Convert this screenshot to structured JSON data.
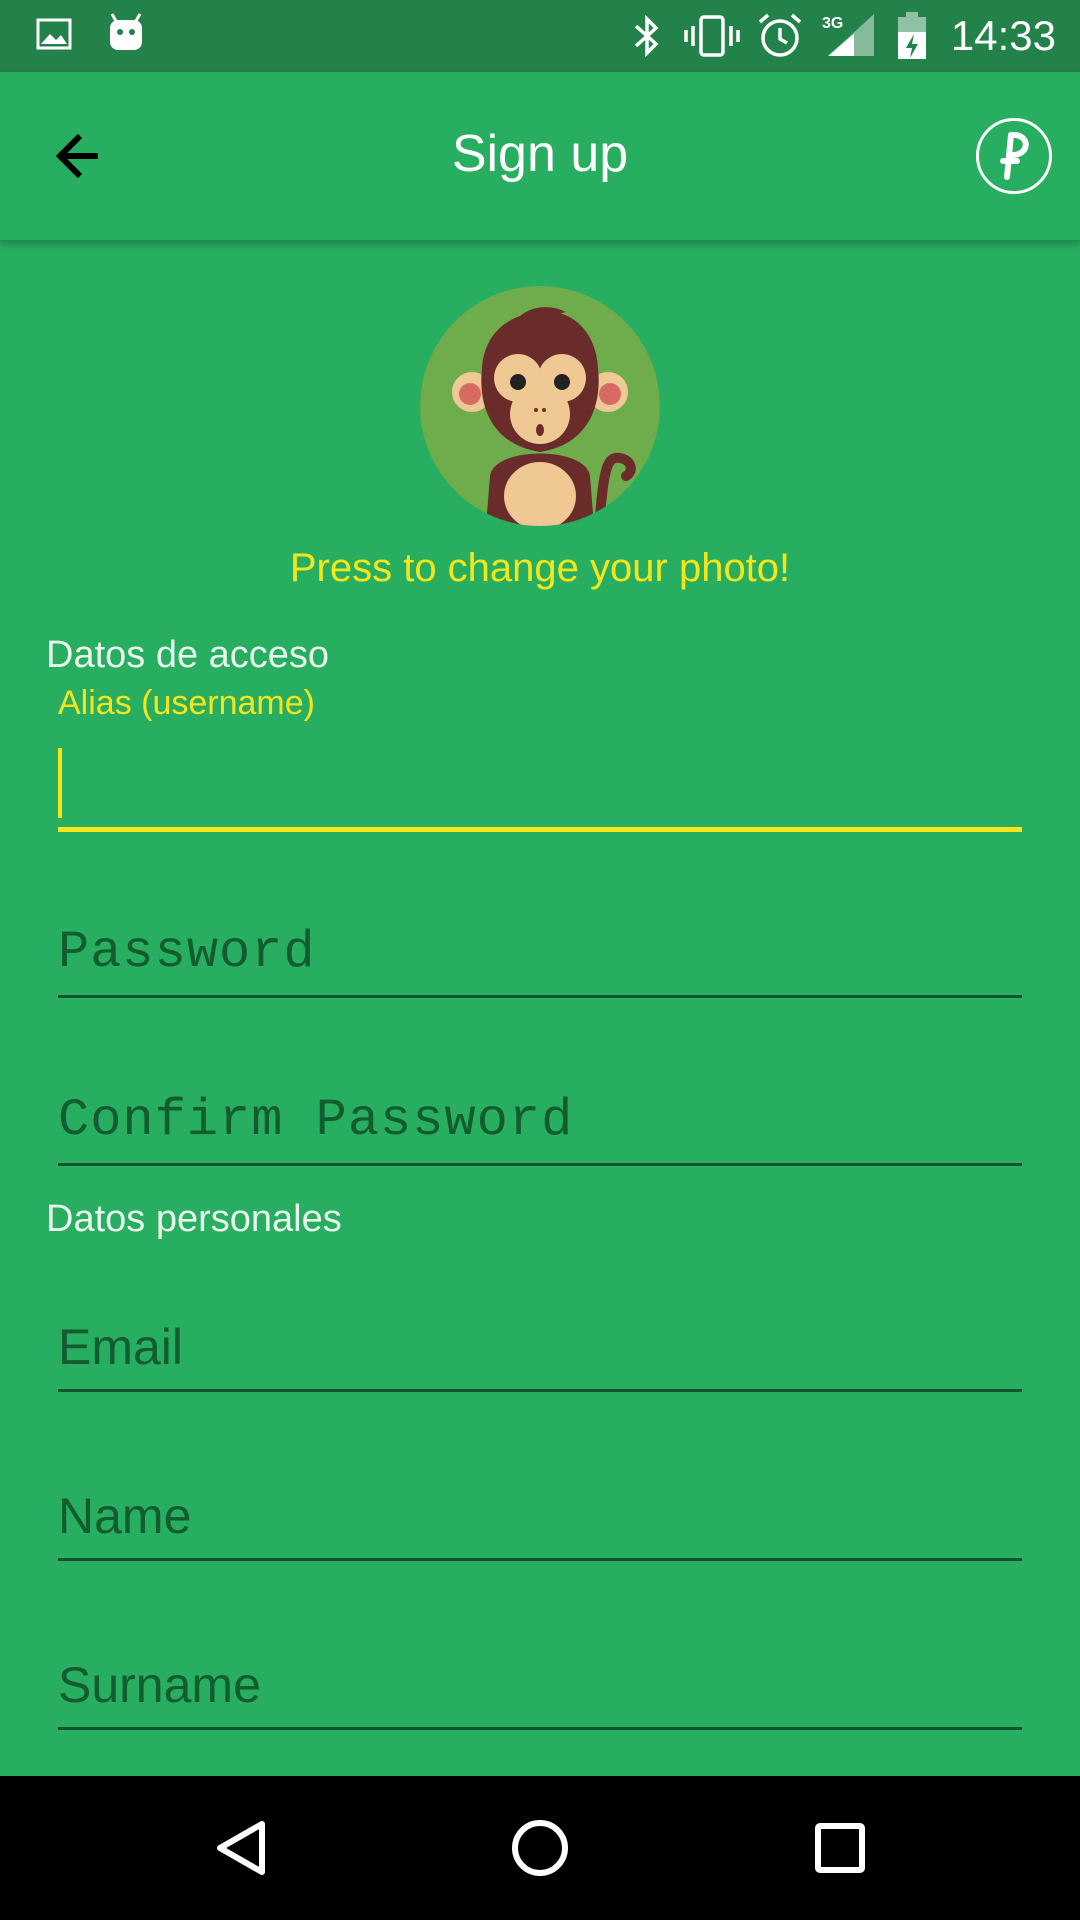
{
  "status_bar": {
    "time": "14:33",
    "icons": [
      "image-icon",
      "android-icon",
      "bluetooth-icon",
      "vibrate-icon",
      "alarm-icon",
      "signal-3g-icon",
      "battery-icon"
    ],
    "network": "3G"
  },
  "app_bar": {
    "title": "Sign up",
    "back_icon": "arrow-back-icon",
    "logo_icon": "app-logo-icon"
  },
  "profile": {
    "photo_hint": "Press to change your photo!",
    "avatar_icon": "monkey-avatar"
  },
  "access_section": {
    "title": "Datos de acceso",
    "alias_label": "Alias (username)",
    "alias_value": "",
    "password_placeholder": "Password",
    "confirm_placeholder": "Confirm Password"
  },
  "personal_section": {
    "title": "Datos personales",
    "email_placeholder": "Email",
    "name_placeholder": "Name",
    "surname_placeholder": "Surname"
  },
  "nav_bar": {
    "buttons": [
      "back-triangle-icon",
      "home-circle-icon",
      "recents-square-icon"
    ]
  },
  "colors": {
    "primary": "#27ae60",
    "status_bar": "#23824a",
    "accent": "#f4e61a",
    "field_line": "#14532d"
  }
}
